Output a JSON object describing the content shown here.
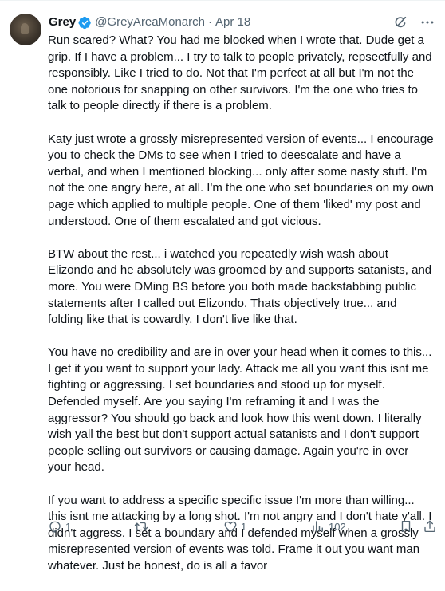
{
  "author": {
    "name": "Grey",
    "handle": "@GreyAreaMonarch",
    "separator": "·",
    "date": "Apr 18"
  },
  "tweet": {
    "paragraphs": [
      "Run scared? What? You had me blocked when I wrote that. Dude get a grip. If I have a problem... I try to talk to people privately, repsectfully and responsibly. Like I tried to do. Not that I'm perfect at all but I'm not the one notorious for snapping on other survivors. I'm the one who tries to talk to people directly if there is a problem.",
      "Katy just wrote a grossly misrepresented version of events... I encourage you to check the DMs to see when I tried to deescalate and have a verbal, and when I mentioned blocking... only after some nasty stuff. I'm not the one angry here, at all. I'm the one who set boundaries on my own page which applied to multiple people. One of them 'liked' my post and understood. One of them escalated and got vicious.",
      "BTW about the rest... i watched you repeatedly wish wash about Elizondo and he absolutely was groomed by and supports satanists, and more. You were DMing BS before you both made backstabbing public statements after I called out Elizondo. Thats objectively true... and folding like that is cowardly. I don't live like that.",
      "You have no credibility and are in over your head when it comes to this... I get it you want to support your lady. Attack me all you want this isnt me fighting or aggressing. I set boundaries and stood up for myself. Defended myself. Are you saying I'm reframing it and I was the aggressor? You should go back and look how this went down. I literally wish yall the best but don't support actual satanists and I don't support people selling out survivors or causing damage. Again you're in over your head.",
      "If you want to address a specific specific issue I'm more than willing... this isnt me attacking by a long shot. I'm not angry and I don't hate y'all. I didn't aggress. I set a boundary and I defended myself when a grossly misrepresented version of events was told. Frame it out you want man whatever. Just be honest, do is all a favor"
    ]
  },
  "actions": {
    "replies": "1",
    "retweets": "",
    "likes": "1",
    "views": "102"
  },
  "icons": {
    "verified": "verified-badge-icon",
    "grok": "grok-icon",
    "more": "more-icon",
    "reply": "reply-icon",
    "retweet": "retweet-icon",
    "like": "like-icon",
    "views": "views-icon",
    "bookmark": "bookmark-icon",
    "share": "share-icon"
  },
  "colors": {
    "text": "#0f1419",
    "secondary": "#536471",
    "verified": "#1d9bf0"
  }
}
